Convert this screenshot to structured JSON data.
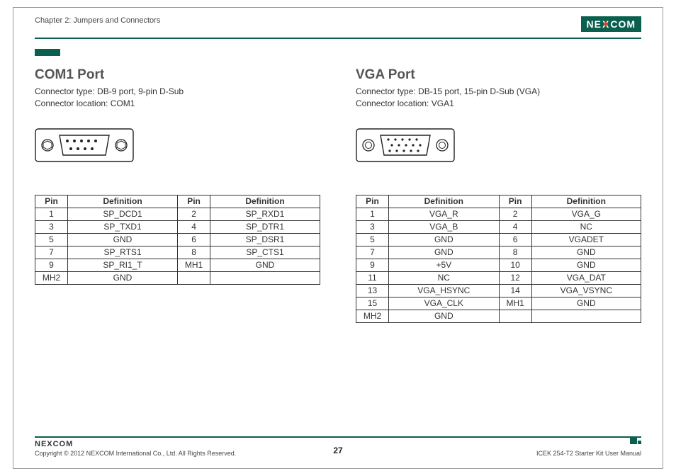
{
  "header": {
    "chapter": "Chapter 2: Jumpers and Connectors",
    "brand_n": "NE",
    "brand_x": "X",
    "brand_com": "COM"
  },
  "com1": {
    "title": "COM1 Port",
    "type": "Connector type: DB-9 port, 9-pin D-Sub",
    "location": "Connector location: COM1",
    "table": {
      "h_pin": "Pin",
      "h_def": "Definition",
      "rows": [
        {
          "p1": "1",
          "d1": "SP_DCD1",
          "p2": "2",
          "d2": "SP_RXD1"
        },
        {
          "p1": "3",
          "d1": "SP_TXD1",
          "p2": "4",
          "d2": "SP_DTR1"
        },
        {
          "p1": "5",
          "d1": "GND",
          "p2": "6",
          "d2": "SP_DSR1"
        },
        {
          "p1": "7",
          "d1": "SP_RTS1",
          "p2": "8",
          "d2": "SP_CTS1"
        },
        {
          "p1": "9",
          "d1": "SP_RI1_T",
          "p2": "MH1",
          "d2": "GND"
        },
        {
          "p1": "MH2",
          "d1": "GND",
          "p2": "",
          "d2": ""
        }
      ]
    }
  },
  "vga": {
    "title": "VGA Port",
    "type": "Connector type: DB-15 port, 15-pin D-Sub (VGA)",
    "location": "Connector location: VGA1",
    "table": {
      "h_pin": "Pin",
      "h_def": "Definition",
      "rows": [
        {
          "p1": "1",
          "d1": "VGA_R",
          "p2": "2",
          "d2": "VGA_G"
        },
        {
          "p1": "3",
          "d1": "VGA_B",
          "p2": "4",
          "d2": "NC"
        },
        {
          "p1": "5",
          "d1": "GND",
          "p2": "6",
          "d2": "VGADET"
        },
        {
          "p1": "7",
          "d1": "GND",
          "p2": "8",
          "d2": "GND"
        },
        {
          "p1": "9",
          "d1": "+5V",
          "p2": "10",
          "d2": "GND"
        },
        {
          "p1": "11",
          "d1": "NC",
          "p2": "12",
          "d2": "VGA_DAT"
        },
        {
          "p1": "13",
          "d1": "VGA_HSYNC",
          "p2": "14",
          "d2": "VGA_VSYNC"
        },
        {
          "p1": "15",
          "d1": "VGA_CLK",
          "p2": "MH1",
          "d2": "GND"
        },
        {
          "p1": "MH2",
          "d1": "GND",
          "p2": "",
          "d2": ""
        }
      ]
    }
  },
  "footer": {
    "brand": "NEXCOM",
    "copyright": "Copyright © 2012 NEXCOM International Co., Ltd. All Rights Reserved.",
    "page": "27",
    "doc": "ICEK 254-T2 Starter Kit User Manual"
  }
}
